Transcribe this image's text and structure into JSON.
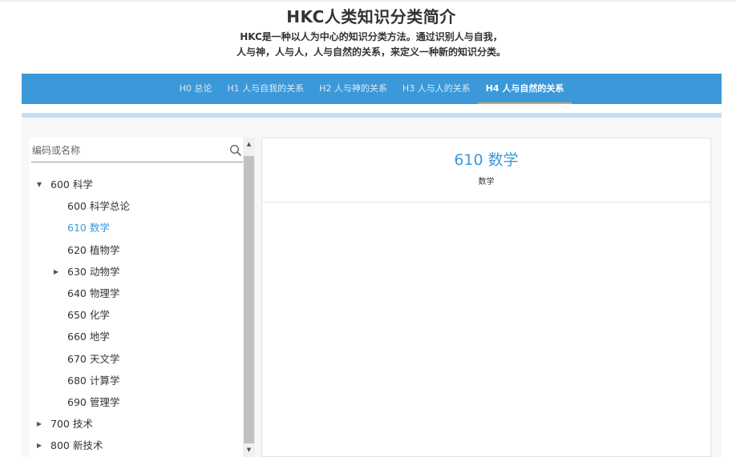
{
  "header": {
    "title": "HKC人类知识分类简介",
    "subtitle_line1": "HKC是一种以人为中心的知识分类方法。通过识别人与自我，",
    "subtitle_line2": "人与神，人与人，人与自然的关系，来定义一种新的知识分类。"
  },
  "nav": {
    "tabs": [
      {
        "label": "H0 总论",
        "active": false
      },
      {
        "label": "H1 人与自我的关系",
        "active": false
      },
      {
        "label": "H2 人与神的关系",
        "active": false
      },
      {
        "label": "H3 人与人的关系",
        "active": false
      },
      {
        "label": "H4 人与自然的关系",
        "active": true
      }
    ],
    "bar_color": "#3b99d9",
    "active_underline_color": "#e0a74c"
  },
  "search": {
    "placeholder": "编码或名称",
    "value": ""
  },
  "tree": {
    "items": [
      {
        "label": "600 科学",
        "level": 0,
        "toggle": "expanded",
        "selected": false
      },
      {
        "label": "600 科学总论",
        "level": 1,
        "toggle": "none",
        "selected": false
      },
      {
        "label": "610 数学",
        "level": 1,
        "toggle": "none",
        "selected": true
      },
      {
        "label": "620 植物学",
        "level": 1,
        "toggle": "none",
        "selected": false
      },
      {
        "label": "630 动物学",
        "level": 1,
        "toggle": "collapsed",
        "selected": false
      },
      {
        "label": "640 物理学",
        "level": 1,
        "toggle": "none",
        "selected": false
      },
      {
        "label": "650 化学",
        "level": 1,
        "toggle": "none",
        "selected": false
      },
      {
        "label": "660 地学",
        "level": 1,
        "toggle": "none",
        "selected": false
      },
      {
        "label": "670 天文学",
        "level": 1,
        "toggle": "none",
        "selected": false
      },
      {
        "label": "680 计算学",
        "level": 1,
        "toggle": "none",
        "selected": false
      },
      {
        "label": "690 管理学",
        "level": 1,
        "toggle": "none",
        "selected": false
      },
      {
        "label": "700 技术",
        "level": 0,
        "toggle": "collapsed",
        "selected": false
      },
      {
        "label": "800 新技术",
        "level": 0,
        "toggle": "collapsed",
        "selected": false
      }
    ],
    "selected_color": "#3b99d9"
  },
  "detail": {
    "title": "610 数学",
    "subtitle": "数学"
  },
  "icons": {
    "search": "search-icon",
    "expanded": "triangle-down-icon",
    "collapsed": "triangle-right-icon",
    "scroll_up": "scroll-up-arrow-icon",
    "scroll_down": "scroll-down-arrow-icon"
  }
}
